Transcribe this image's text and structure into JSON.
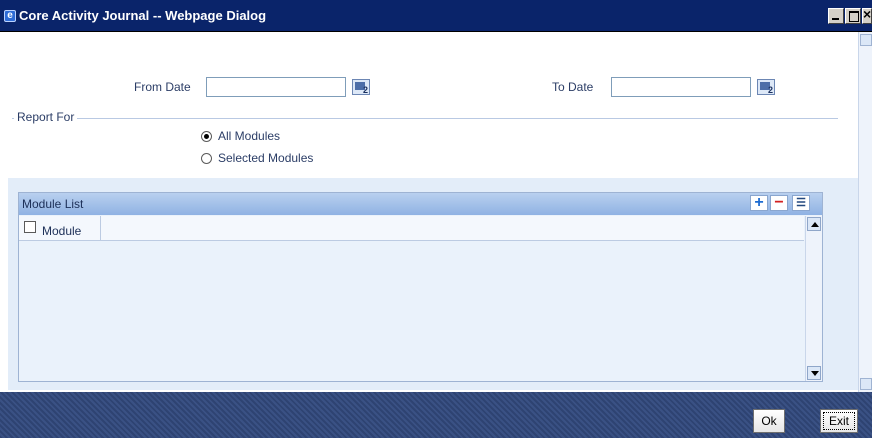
{
  "window": {
    "title": "Core Activity Journal -- Webpage Dialog"
  },
  "form": {
    "from_date_label": "From Date",
    "from_date_value": "",
    "to_date_label": "To Date",
    "to_date_value": ""
  },
  "report_for": {
    "legend": "Report For",
    "options": [
      {
        "label": "All Modules",
        "selected": true
      },
      {
        "label": "Selected Modules",
        "selected": false
      }
    ]
  },
  "module_list": {
    "title": "Module List",
    "columns": [
      "Module"
    ],
    "rows": []
  },
  "footer": {
    "ok_label": "Ok",
    "exit_label": "Exit"
  },
  "icons": {
    "window": "ie-icon",
    "calendar": "calendar-icon",
    "add": "plus-icon",
    "delete": "minus-icon",
    "details": "list-icon"
  },
  "colors": {
    "titlebar": "#0a246a",
    "panel": "#e3edf9",
    "footer": "#2e4372"
  }
}
